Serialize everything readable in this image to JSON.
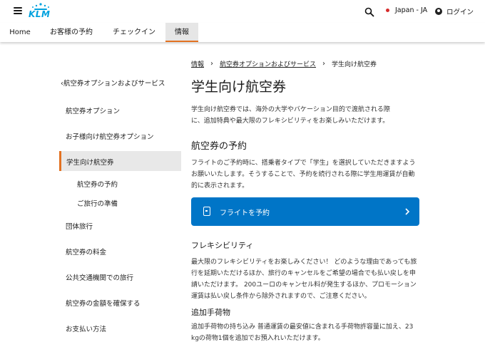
{
  "header": {
    "logo_text": "KLM",
    "locale": "Japan - JA",
    "login": "ログイン"
  },
  "nav": {
    "tabs": [
      "Home",
      "お客様の予約",
      "チェックイン",
      "情報"
    ],
    "active_tab": "情報"
  },
  "sidebar": {
    "back": "航空券オプションおよびサービス",
    "items": [
      "航空券オプション",
      "お子様向け航空券オプション",
      "学生向け航空券",
      "航空券の予約",
      "ご旅行の準備",
      "団体旅行",
      "航空券の料金",
      "公共交通機関での旅行",
      "航空券の金額を確保する",
      "お支払い方法"
    ],
    "active_item": "学生向け航空券"
  },
  "breadcrumb": {
    "items": [
      "情報",
      "航空券オプションおよびサービス",
      "学生向け航空券"
    ]
  },
  "main": {
    "title": "学生向け航空券",
    "intro_line1": "学生向け航空券では、海外の大学やバケーション目的で渡航される際",
    "intro_line2": "に、追加特典や最大限のフレキシビリティをお楽しみいただけます。",
    "section1_title": "航空券の予約",
    "section1_line1": "フライトのご予約時に、搭乗者タイプで「学生」を選択していただきますよう",
    "section1_line2": "お願いいたします。そうすることで、予約を続行される際に学生用運賃が自動",
    "section1_line3": "的に表示されます。",
    "book_button": "フライトを予約",
    "section2_title": "フレキシビリティ",
    "section2_line1": "最大限のフレキシビリティをお楽しみください！ どのような理由であっても旅",
    "section2_line2": "行を延期いただけるほか、旅行のキャンセルをご希望の場合でも払い戻しを申",
    "section2_line3": "請いただけます。 200ユーロのキャンセル料が発生するほか、プロモーション",
    "section2_line4": "運賃は払い戻し条件から除外されますので、ご注意ください。",
    "section3_title": "追加手荷物",
    "section3_line1": "追加手荷物の持ち込み 普通運賃の最安値に含まれる手荷物許容量に加え、23",
    "section3_line2": "kgの荷物1個を追加でお預入れいただけます。"
  },
  "colors": {
    "brand": "#00a1de",
    "accent": "#e37222",
    "button": "#0075c7"
  }
}
